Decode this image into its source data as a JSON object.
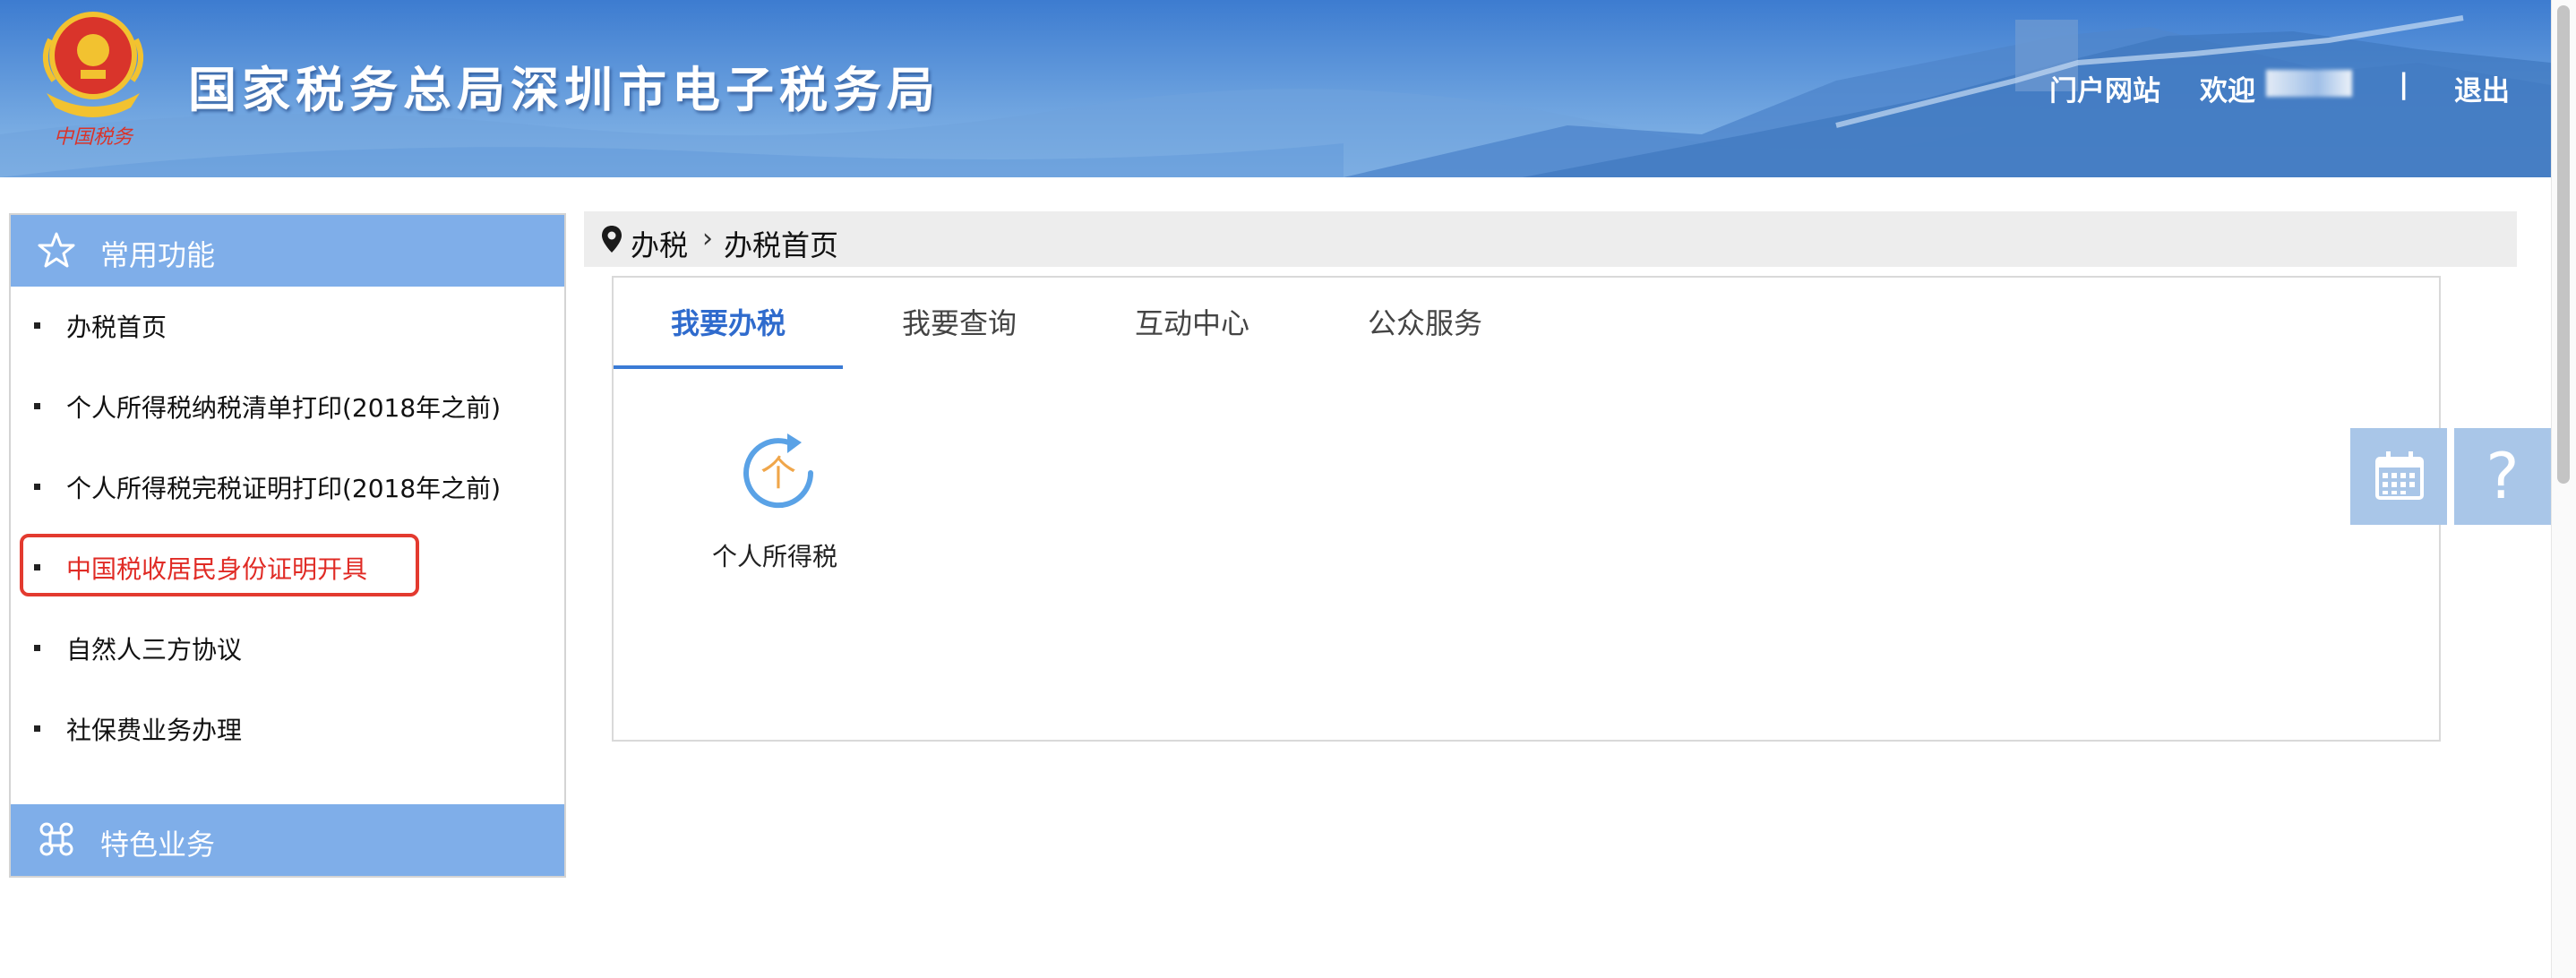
{
  "header": {
    "logo_caption": "中国税务",
    "site_title": "国家税务总局深圳市电子税务局",
    "portal_link": "门户网站",
    "welcome_text": "欢迎",
    "separator": "|",
    "logout_label": "退出"
  },
  "sidebar": {
    "common_title": "常用功能",
    "items": [
      {
        "label": "办税首页"
      },
      {
        "label": "个人所得税纳税清单打印(2018年之前)"
      },
      {
        "label": "个人所得税完税证明打印(2018年之前)"
      },
      {
        "label": "中国税收居民身份证明开具",
        "highlighted": true
      },
      {
        "label": "自然人三方协议"
      },
      {
        "label": "社保费业务办理"
      }
    ],
    "featured_title": "特色业务"
  },
  "breadcrumb": {
    "level1": "办税",
    "separator": "›",
    "level2": "办税首页"
  },
  "tabs": [
    {
      "label": "我要办税",
      "active": true
    },
    {
      "label": "我要查询"
    },
    {
      "label": "互动中心"
    },
    {
      "label": "公众服务"
    }
  ],
  "services": [
    {
      "label": "个人所得税",
      "icon": "individual-income-tax-icon",
      "icon_glyph": "个"
    }
  ],
  "float_tools": {
    "calendar_icon": "calendar-icon",
    "help_glyph": "?"
  },
  "colors": {
    "banner_blue": "#3a7bd5",
    "sidebar_header": "#7faee9",
    "active_tab": "#2f6bcd",
    "highlight_red": "#e33a2f",
    "float_button": "#a9c6e8",
    "tile_icon_blue": "#5aa2e6",
    "tile_icon_orange": "#f0a64a"
  }
}
